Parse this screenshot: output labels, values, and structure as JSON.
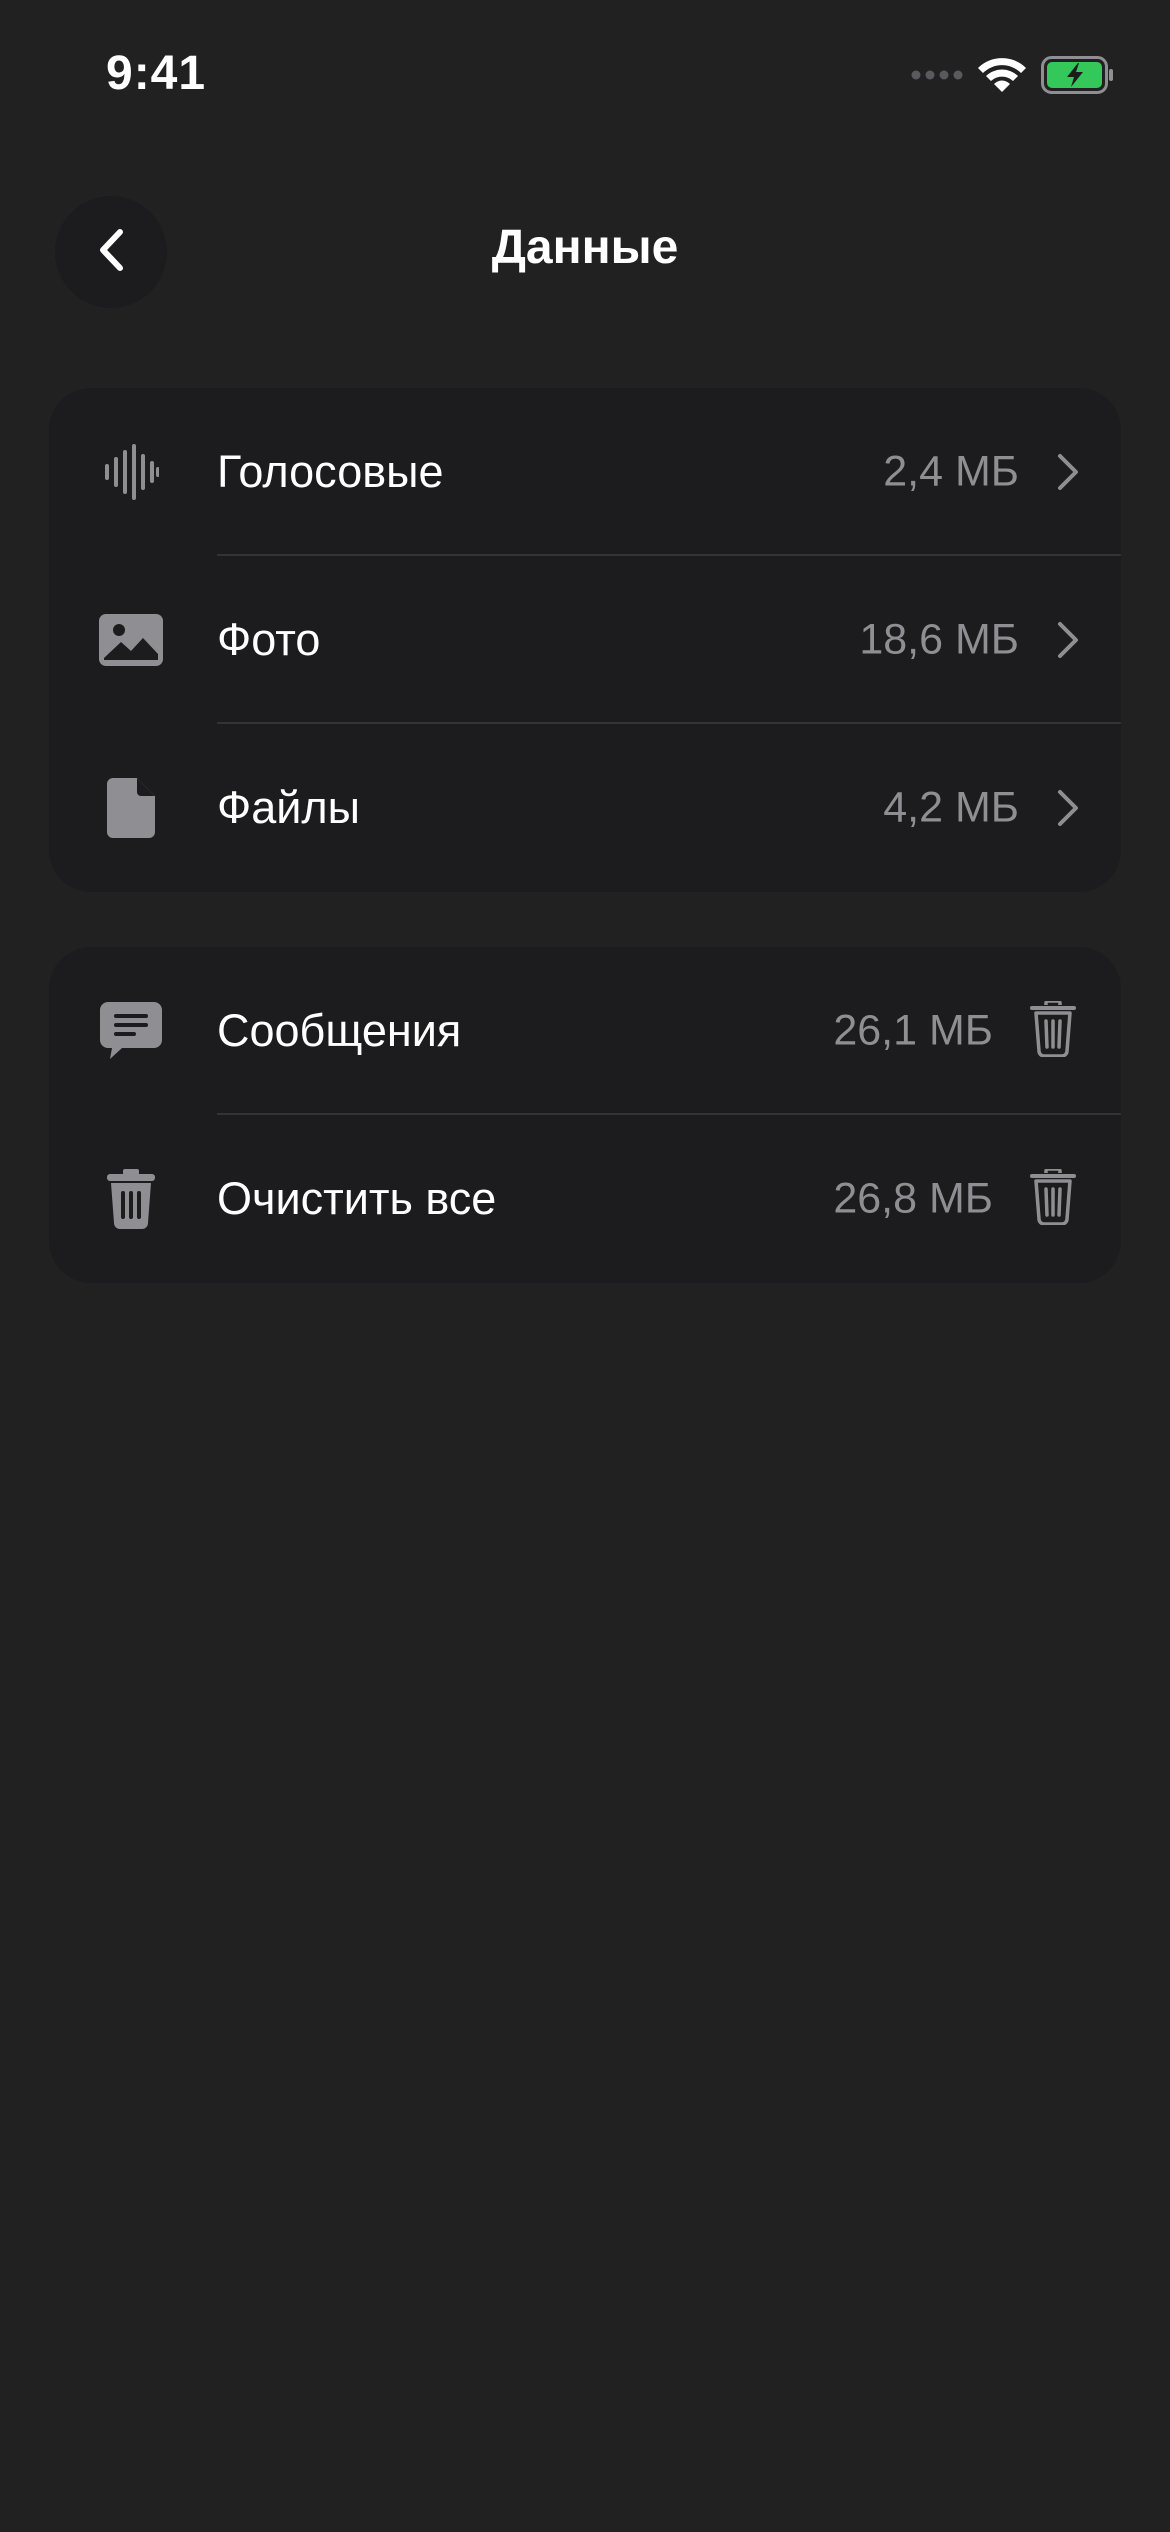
{
  "status_bar": {
    "time": "9:41"
  },
  "header": {
    "title": "Данные",
    "back_icon": "chevron-left-icon"
  },
  "media_section": {
    "items": [
      {
        "label": "Голосовые",
        "value": "2,4 МБ",
        "icon": "waveform-icon"
      },
      {
        "label": "Фото",
        "value": "18,6 МБ",
        "icon": "photo-icon"
      },
      {
        "label": "Файлы",
        "value": "4,2 МБ",
        "icon": "file-icon"
      }
    ]
  },
  "clear_section": {
    "items": [
      {
        "label": "Сообщения",
        "value": "26,1 МБ",
        "icon": "message-icon"
      },
      {
        "label": "Очистить все",
        "value": "26,8 МБ",
        "icon": "trash-icon"
      }
    ]
  },
  "colors": {
    "background": "#212121",
    "card": "#1c1c1e",
    "primary_text": "#ffffff",
    "secondary_text": "#8e8e93",
    "icon": "#8e8e93",
    "battery": "#34c759"
  }
}
